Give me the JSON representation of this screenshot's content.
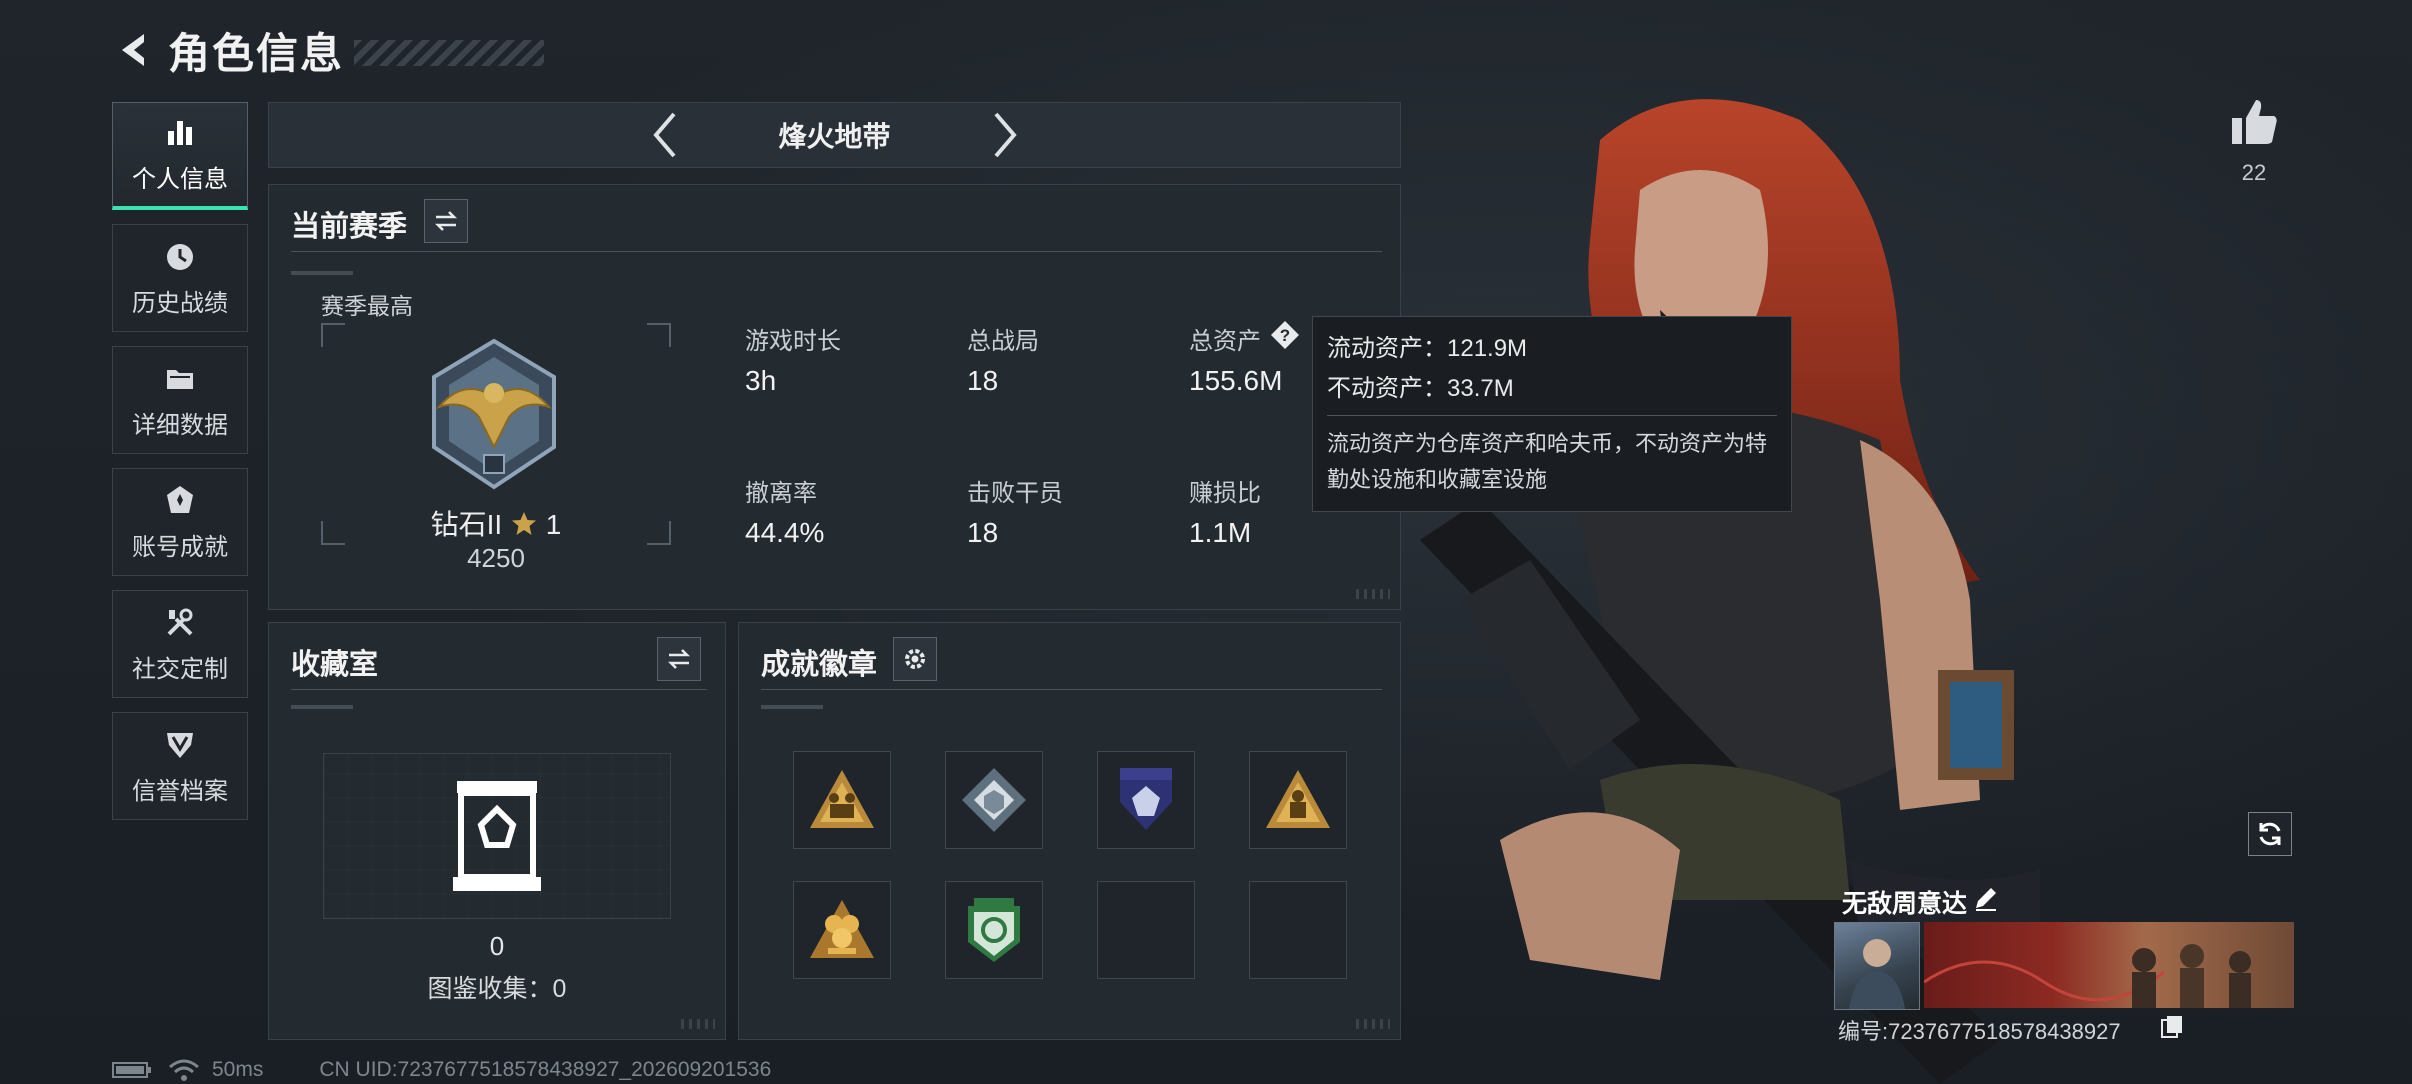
{
  "header": {
    "title": "角色信息"
  },
  "nav": {
    "items": [
      {
        "label": "个人信息",
        "icon": "bar-chart-icon",
        "active": true
      },
      {
        "label": "历史战绩",
        "icon": "clock-icon"
      },
      {
        "label": "详细数据",
        "icon": "folder-icon"
      },
      {
        "label": "账号成就",
        "icon": "achievement-icon"
      },
      {
        "label": "社交定制",
        "icon": "tools-icon"
      },
      {
        "label": "信誉档案",
        "icon": "shield-v-icon"
      }
    ]
  },
  "mode": {
    "title": "烽火地带"
  },
  "season": {
    "title": "当前赛季",
    "best_label": "赛季最高",
    "rank_name": "钻石II",
    "rank_stars": "1",
    "rank_score": "4250",
    "stats": [
      {
        "label": "游戏时长",
        "value": "3h"
      },
      {
        "label": "总战局",
        "value": "18"
      },
      {
        "label": "总资产",
        "value": "155.6M"
      },
      {
        "label": "撤离率",
        "value": "44.4%"
      },
      {
        "label": "击败干员",
        "value": "18"
      },
      {
        "label": "赚损比",
        "value": "1.1M"
      }
    ]
  },
  "tooltip": {
    "liquid": "流动资产：121.9M",
    "fixed": "不动资产：33.7M",
    "desc": "流动资产为仓库资产和哈夫币，不动资产为特勤处设施和收藏室设施"
  },
  "collection": {
    "title": "收藏室",
    "count": "0",
    "codex": "图鉴收集：0"
  },
  "badges": {
    "title": "成就徽章",
    "items": [
      {
        "icon": "soldiers-triangle-badge-icon"
      },
      {
        "icon": "diamond-cube-badge-icon"
      },
      {
        "icon": "blue-shield-badge-icon"
      },
      {
        "icon": "soldier-triangle-badge-icon"
      },
      {
        "icon": "gold-cluster-badge-icon"
      },
      {
        "icon": "green-emblem-badge-icon"
      },
      {
        "icon": "empty-slot"
      },
      {
        "icon": "empty-slot"
      }
    ]
  },
  "profile": {
    "likes": "22",
    "name": "无敌周意达",
    "id": "编号:7237677518578438927"
  },
  "status": {
    "ping": "50ms",
    "uid": "CN UID:7237677518578438927_202609201536"
  },
  "colors": {
    "accent": "#3fe0b0",
    "panel": "#232a30",
    "bg": "#1c2127"
  }
}
